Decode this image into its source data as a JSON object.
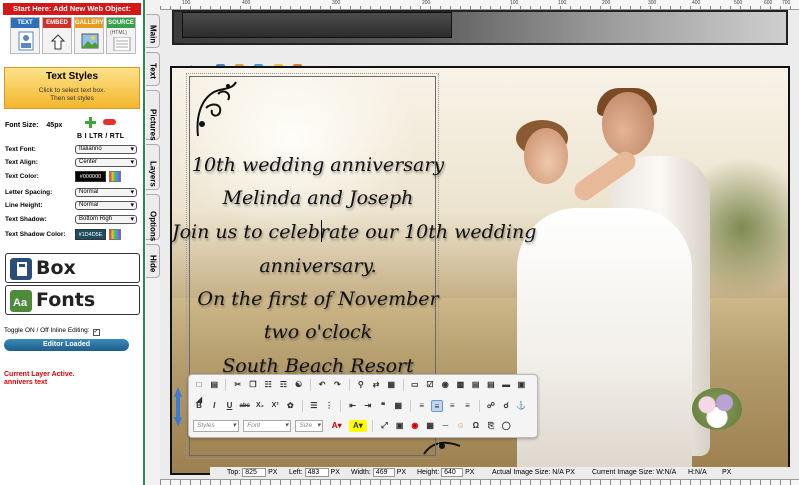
{
  "left_panel": {
    "start_banner": "Start Here: Add New Web Object:",
    "object_buttons": [
      {
        "label": "TEXT",
        "color": "#2f6fb8"
      },
      {
        "label": "EMBED",
        "color": "#d0302a"
      },
      {
        "label": "GALLERY",
        "color": "#e89a1e"
      },
      {
        "label": "SOURCE",
        "color": "#36a04a"
      }
    ],
    "source_caption": "(HTML)",
    "text_styles": {
      "title": "Text Styles",
      "sub1": "Click to select text box.",
      "sub2": "Then set styles"
    },
    "font_size_label": "Font Size:",
    "font_size_value": "45px",
    "format_row": "B  I    LTR / RTL",
    "properties": [
      {
        "label": "Text Font:",
        "value": "Italianno"
      },
      {
        "label": "Text Align:",
        "value": "Center"
      },
      {
        "label": "Text Color:",
        "value": "#000000"
      },
      {
        "label": "Letter Spacing:",
        "value": "Normal"
      },
      {
        "label": "Line Height:",
        "value": "Normal"
      },
      {
        "label": "Text Shadow:",
        "value": "Bottom Righ"
      },
      {
        "label": "Text Shadow Color:",
        "value": "#1D4D5E"
      }
    ],
    "box_button": "Box",
    "fonts_button": "Fonts",
    "toggle_label": "Toggle ON / Off Inline Editing:",
    "editor_loaded": "Editor Loaded",
    "current_layer_line1": "Current Layer Active.",
    "current_layer_line2": "annivers text"
  },
  "tabs": [
    "Main",
    "Text",
    "Pictures",
    "Layers",
    "Options",
    "Hide"
  ],
  "ruler_numbers": [
    "100",
    "400",
    "300",
    "200",
    "100",
    "100",
    "200",
    "300",
    "400",
    "500",
    "600",
    "700"
  ],
  "invitation": {
    "lines": [
      "10th wedding anniversary",
      "Melinda and Joseph",
      "Join us to celebrate our 10th wedding",
      "anniversary.",
      "On the first of November",
      "two o'clock",
      "South Beach Resort"
    ]
  },
  "toolbar": {
    "row2_buttons": [
      "B",
      "I",
      "U",
      "abc",
      "X₂",
      "X²"
    ],
    "styles_combo": "Styles",
    "font_combo": "Font",
    "size_combo": "Size"
  },
  "status_bar": {
    "top_label": "Top:",
    "top_value": "825",
    "left_label": "Left:",
    "left_value": "483",
    "width_label": "Width:",
    "width_value": "469",
    "height_label": "Height:",
    "height_value": "640",
    "px": "PX",
    "actual_size": "Actual Image Size: N/A PX",
    "current_size": "Current Image Size: W:N/A",
    "h_label": "H:N/A",
    "px2": "PX"
  }
}
